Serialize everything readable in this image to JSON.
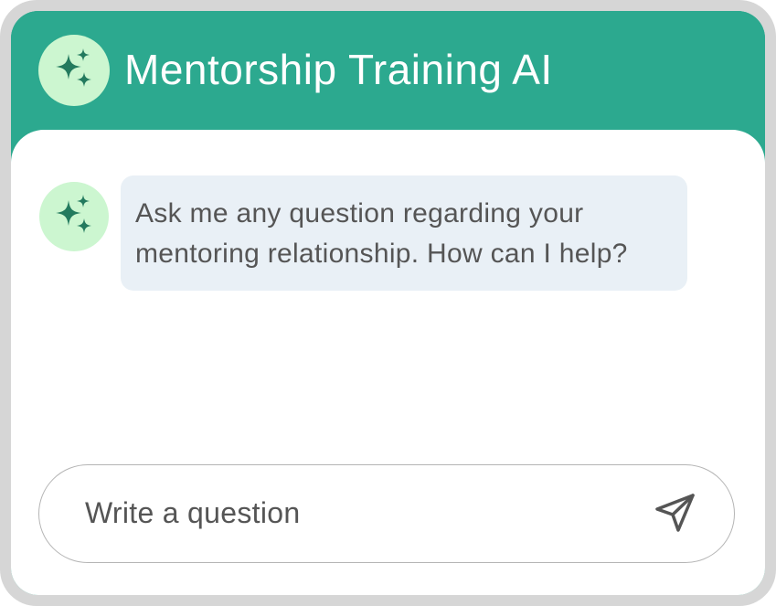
{
  "header": {
    "title": "Mentorship Training AI",
    "avatar_icon": "sparkles-icon"
  },
  "messages": [
    {
      "role": "bot",
      "avatar_icon": "sparkles-icon",
      "text": "Ask me any question regarding your mentoring relationship. How can I help?"
    }
  ],
  "composer": {
    "placeholder": "Write a question",
    "value": "",
    "send_icon": "send-icon"
  },
  "colors": {
    "header_bg": "#2ca98f",
    "avatar_bg": "#ccf6d0",
    "sparkle": "#237a5e",
    "bubble_bg": "#e9f0f6",
    "frame": "#d6d6d6"
  }
}
